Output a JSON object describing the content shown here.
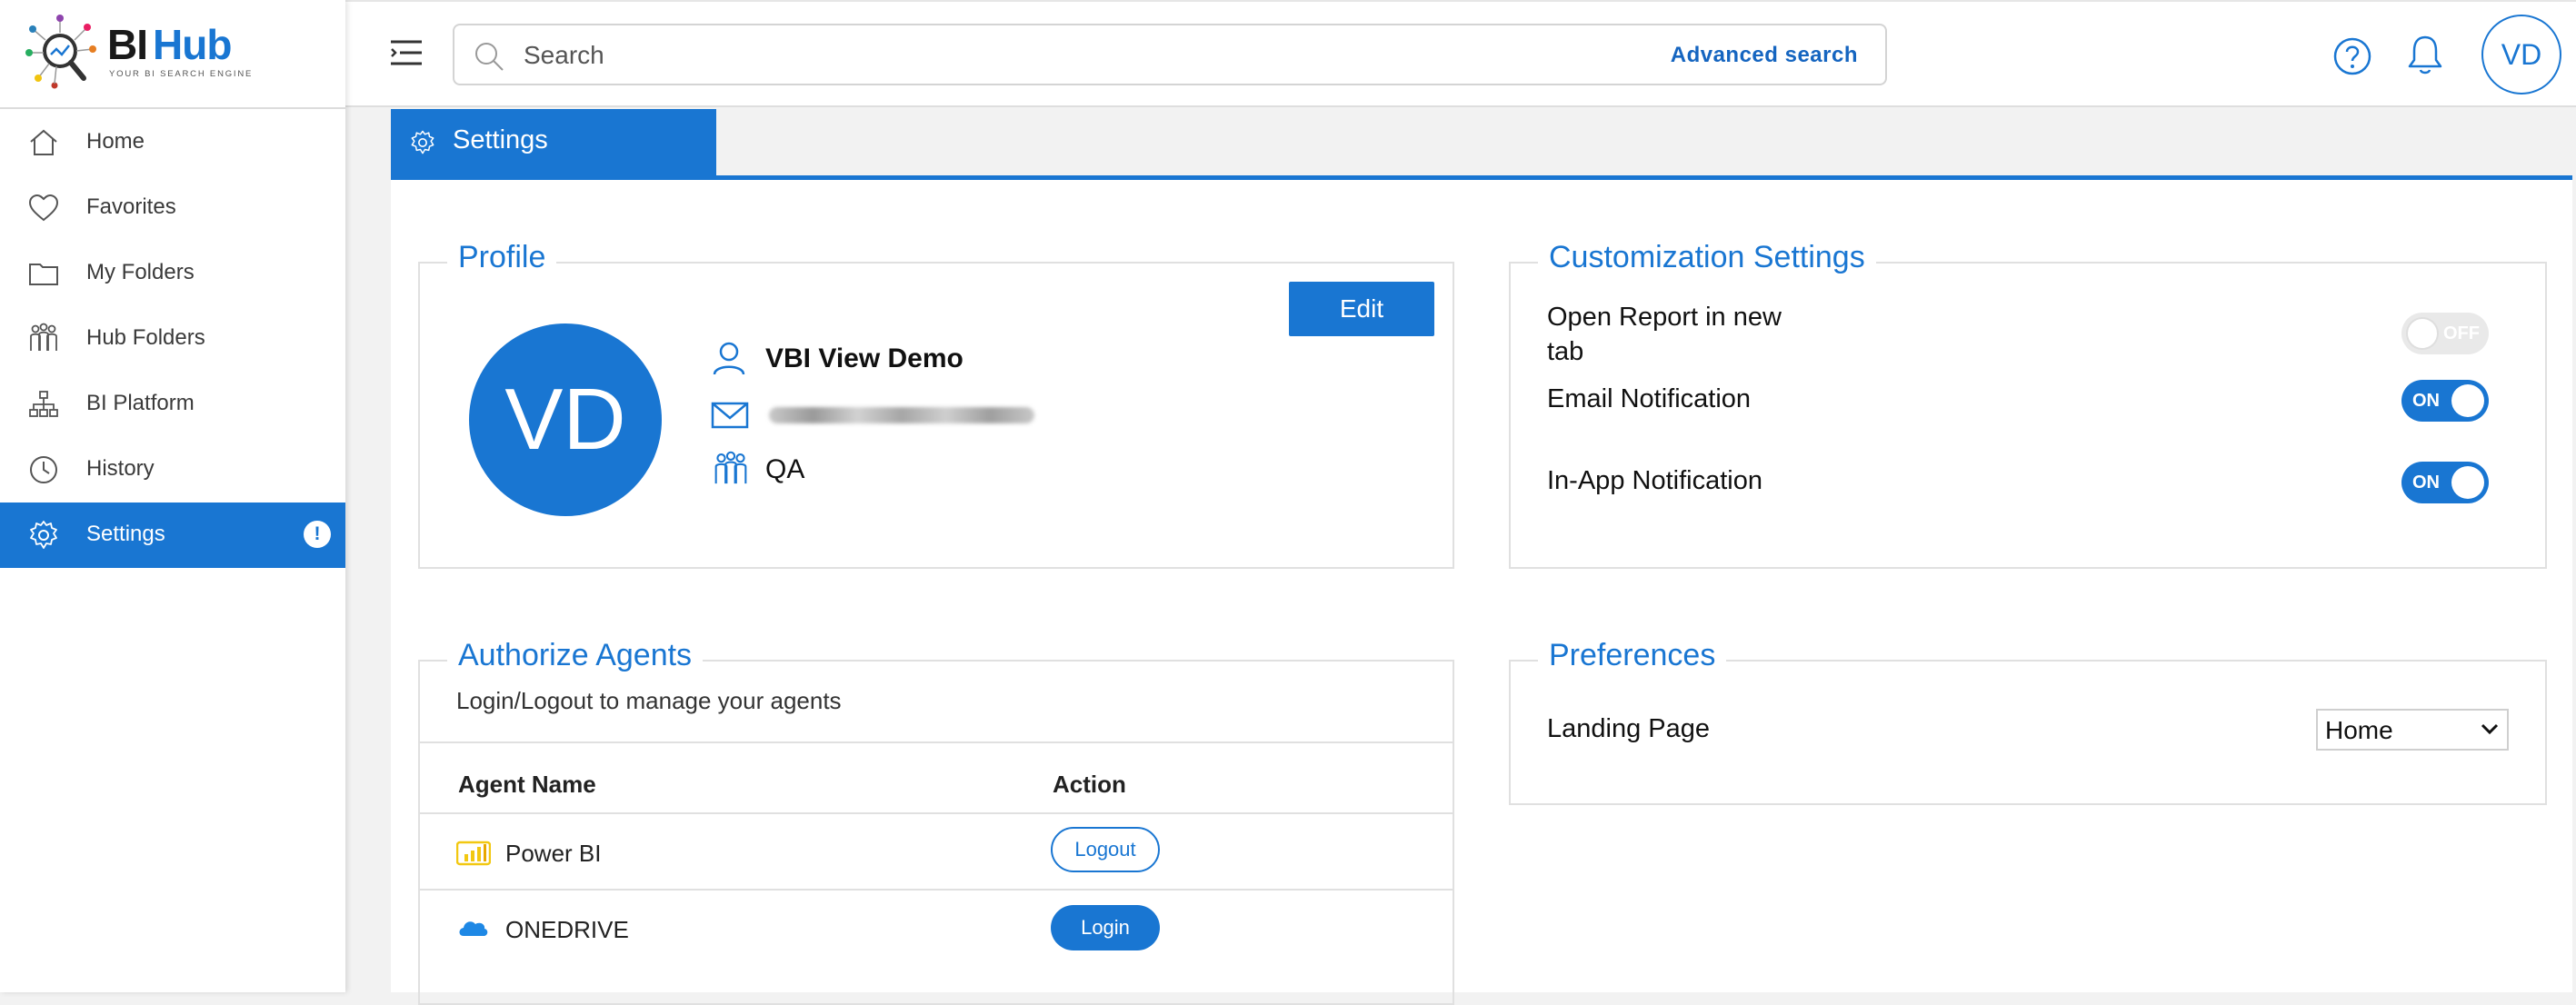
{
  "brand": {
    "name_part1": "BI",
    "name_part2": "Hub",
    "tagline": "YOUR BI SEARCH ENGINE"
  },
  "sidebar": {
    "items": [
      {
        "label": "Home",
        "icon": "home-icon"
      },
      {
        "label": "Favorites",
        "icon": "heart-icon"
      },
      {
        "label": "My Folders",
        "icon": "folder-icon"
      },
      {
        "label": "Hub Folders",
        "icon": "group-icon"
      },
      {
        "label": "BI Platform",
        "icon": "hierarchy-icon"
      },
      {
        "label": "History",
        "icon": "clock-icon"
      },
      {
        "label": "Settings",
        "icon": "gear-icon",
        "active": true,
        "badge": "!"
      }
    ]
  },
  "topbar": {
    "search_placeholder": "Search",
    "advanced_search": "Advanced search",
    "user_initials": "VD"
  },
  "tab": {
    "label": "Settings"
  },
  "profile": {
    "title": "Profile",
    "edit_label": "Edit",
    "initials": "VD",
    "name": "VBI View Demo",
    "group": "QA"
  },
  "customization": {
    "title": "Customization Settings",
    "rows": [
      {
        "label": "Open Report in new tab",
        "state": "OFF"
      },
      {
        "label": "Email Notification",
        "state": "ON"
      },
      {
        "label": "In-App Notification",
        "state": "ON"
      }
    ]
  },
  "agents": {
    "title": "Authorize Agents",
    "subtitle": "Login/Logout to manage your agents",
    "col_name": "Agent Name",
    "col_action": "Action",
    "rows": [
      {
        "name": "Power BI",
        "action": "Logout",
        "icon": "power-bi-icon"
      },
      {
        "name": "ONEDRIVE",
        "action": "Login",
        "icon": "onedrive-icon"
      }
    ]
  },
  "preferences": {
    "title": "Preferences",
    "landing_label": "Landing Page",
    "landing_value": "Home"
  },
  "colors": {
    "accent": "#1976d2",
    "toggle_off": "#e9e9e9",
    "powerbi": "#f2c811"
  }
}
